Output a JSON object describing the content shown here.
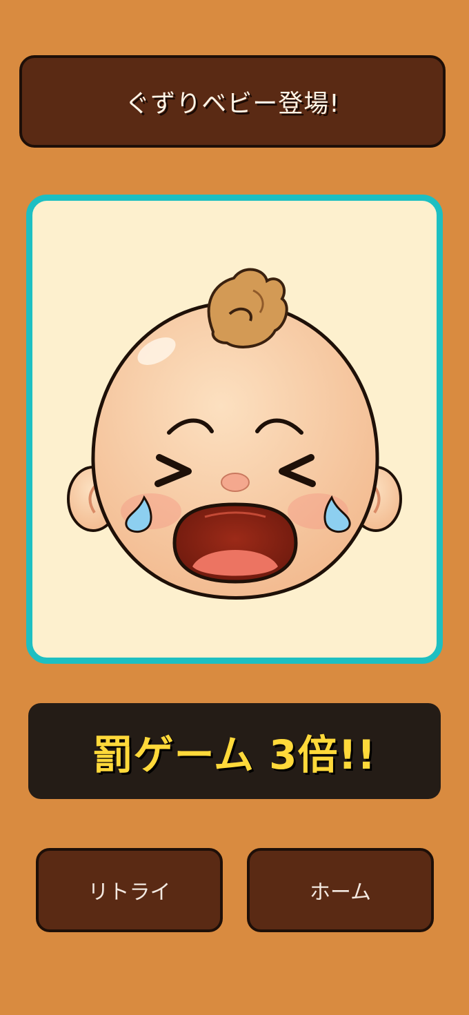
{
  "header": {
    "title": "ぐずりベビー登場!"
  },
  "result_card": {
    "character_icon": "crying-baby-icon",
    "frame_color": "#1DBFC2",
    "background_color": "#FDF0CE"
  },
  "penalty": {
    "text": "罰ゲーム 3倍!!",
    "color": "#FFD93A"
  },
  "buttons": {
    "retry_label": "リトライ",
    "home_label": "ホーム"
  },
  "colors": {
    "background": "#D98B40",
    "button": "#5A2A14",
    "penalty_bar": "#241C16"
  }
}
